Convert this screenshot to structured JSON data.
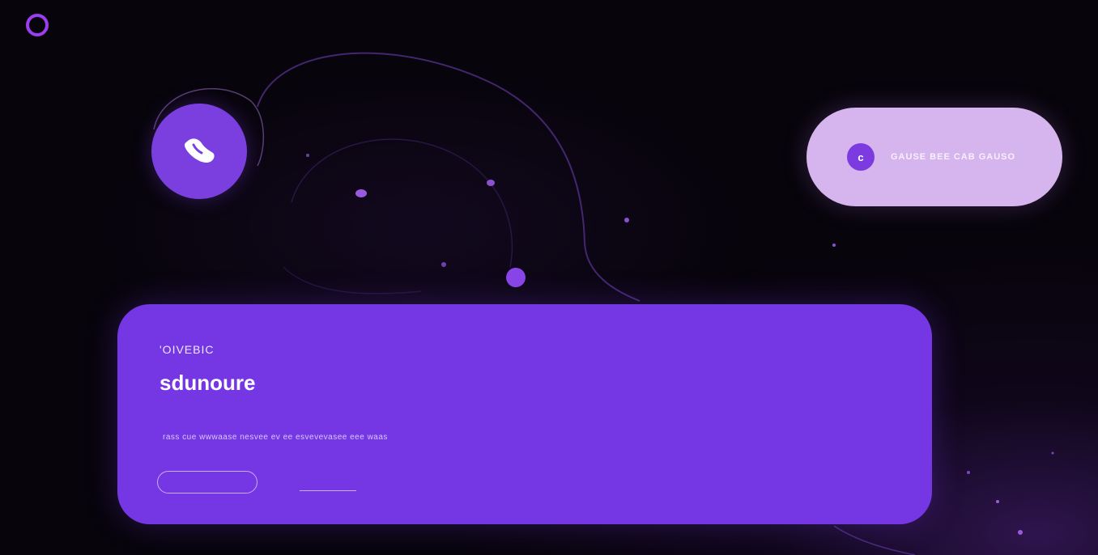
{
  "colors": {
    "background": "#07040b",
    "accent": "#7537e3",
    "accent_bright": "#9b3df0",
    "pill": "#d6b4ee"
  },
  "icons": {
    "logo": "ring-icon",
    "call": "phone-icon",
    "pill": "phone-icon"
  },
  "header": {
    "logo_label": ""
  },
  "call_button": {
    "icon_glyph": "☎"
  },
  "pill_card": {
    "icon_glyph": "c",
    "text": "GAUSE BEE CAB GAUSO"
  },
  "hero": {
    "eyebrow": "'OIVEBIC",
    "title": "sdunoure",
    "description": "rass cue wwwaase nesvee ev ee esvevevasee eee waas",
    "primary_button_label": "",
    "secondary_link_label": ""
  }
}
